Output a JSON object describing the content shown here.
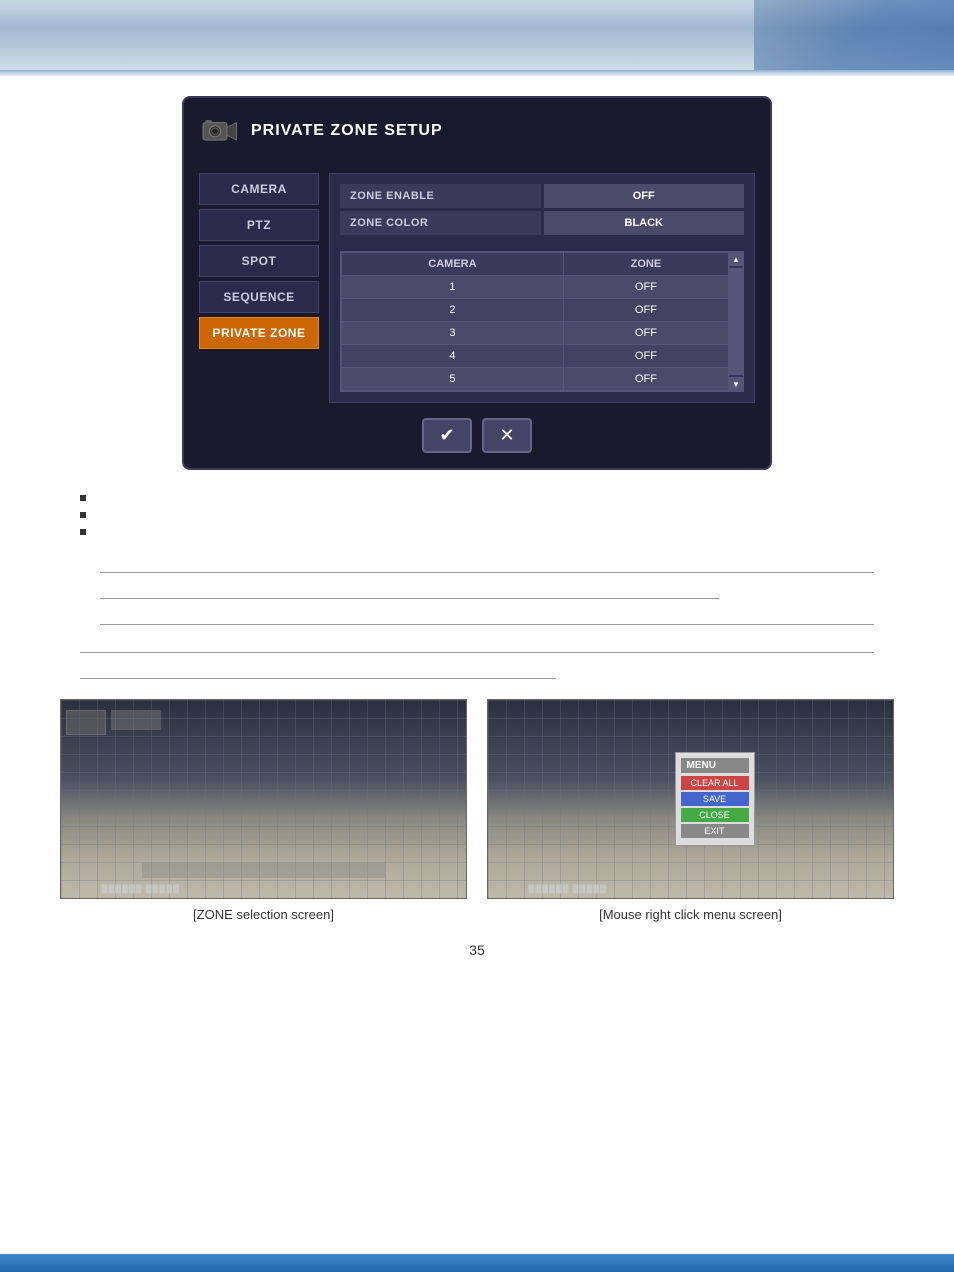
{
  "header": {
    "title": "PRIVATE ZONE SETUP"
  },
  "dialog": {
    "title": "PRIVATE ZONE SETUP",
    "sidebar": {
      "items": [
        {
          "label": "CAMERA",
          "active": false
        },
        {
          "label": "PTZ",
          "active": false
        },
        {
          "label": "SPOT",
          "active": false
        },
        {
          "label": "SEQUENCE",
          "active": false
        },
        {
          "label": "PRIVATE ZONE",
          "active": true
        }
      ]
    },
    "settings": [
      {
        "label": "ZONE ENABLE",
        "value": "OFF"
      },
      {
        "label": "ZONE COLOR",
        "value": "BLACK"
      }
    ],
    "table": {
      "headers": [
        "CAMERA",
        "ZONE"
      ],
      "rows": [
        {
          "camera": "1",
          "zone": "OFF"
        },
        {
          "camera": "2",
          "zone": "OFF"
        },
        {
          "camera": "3",
          "zone": "OFF"
        },
        {
          "camera": "4",
          "zone": "OFF"
        },
        {
          "camera": "5",
          "zone": "OFF"
        }
      ]
    },
    "buttons": {
      "confirm": "✔",
      "cancel": "✕"
    }
  },
  "bullets": [
    {
      "text": ""
    },
    {
      "text": ""
    },
    {
      "text": ""
    }
  ],
  "screenshots": [
    {
      "label": "[ZONE selection screen]",
      "menu": null
    },
    {
      "label": "[Mouse right click menu screen]",
      "menu": {
        "title": "MENU",
        "items": [
          "CLEAR ALL",
          "SAVE",
          "CLOSE",
          "EXIT"
        ]
      }
    }
  ],
  "page_number": "35"
}
